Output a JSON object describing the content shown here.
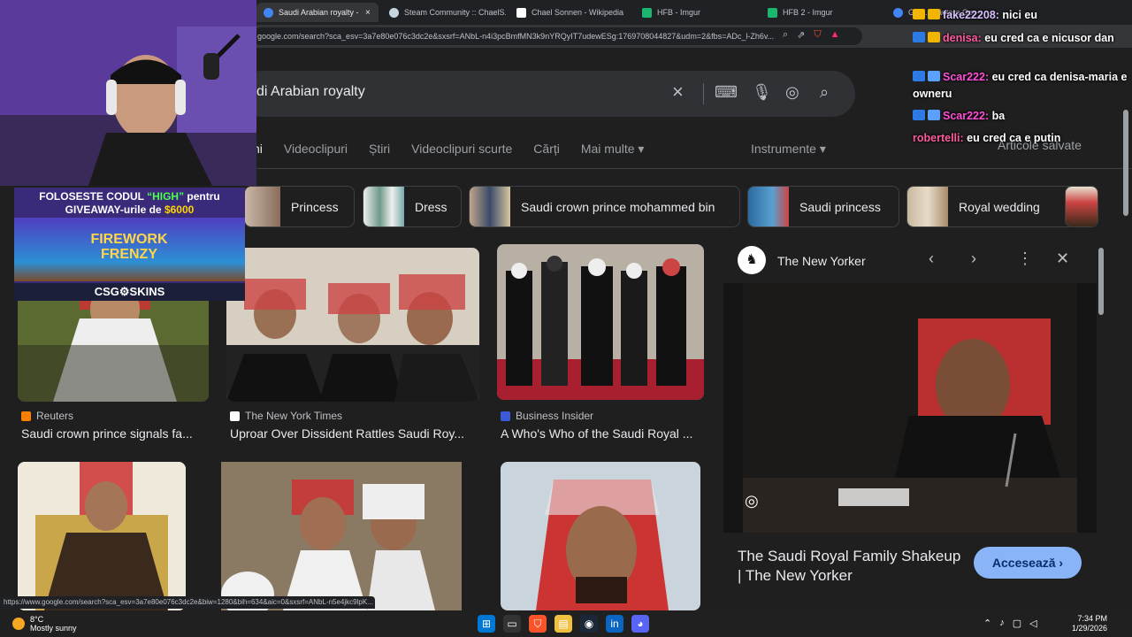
{
  "browser": {
    "tabs": [
      {
        "title": "Saudi Arabian royalty - Căutare Google",
        "active": true
      },
      {
        "title": "Steam Community :: ChaelS."
      },
      {
        "title": "Chael Sonnen - Wikipedia"
      },
      {
        "title": "HFB - Imgur"
      },
      {
        "title": "HFB 2 - Imgur"
      },
      {
        "title": "Gyh... Căutare Google"
      }
    ],
    "tab_close": "×",
    "url": "google.com/search?sca_esv=3a7e80e076c3dc2e&sxsrf=ANbL-n4i3pcBmfMN3k9nYRQyIT7udewESg:1769708044827&udm=2&fbs=ADc_l-Zh6v..."
  },
  "search": {
    "query": "di Arabian royalty",
    "clear_icon": "×"
  },
  "nav": {
    "tabs": [
      "ni",
      "Videoclipuri",
      "Știri",
      "Videoclipuri scurte",
      "Cărți",
      "Mai multe ▾"
    ],
    "tools": "Instrumente ▾",
    "saved": "Articole salvate"
  },
  "chips": [
    "Princess",
    "Dress",
    "Saudi crown prince mohammed bin",
    "Saudi princess",
    "Royal wedding"
  ],
  "results": [
    {
      "source": "Reuters",
      "title": "Saudi crown prince signals fa...",
      "src_color": "#ff8000"
    },
    {
      "source": "The New York Times",
      "title": "Uproar Over Dissident Rattles Saudi Roy...",
      "src_color": "#ffffff"
    },
    {
      "source": "Business Insider",
      "title": "A Who's Who of the Saudi Royal ...",
      "src_color": "#3b5bdb"
    }
  ],
  "panel": {
    "source": "The New Yorker",
    "title": "The Saudi Royal Family Shakeup | The New Yorker",
    "visit_label": "Accesează ›"
  },
  "overlay": {
    "promo_line1_a": "FOLOSESTE CODUL ",
    "promo_code": "“HIGH”",
    "promo_line1_b": " pentru",
    "promo_line2_a": "GIVEAWAY-urile de ",
    "promo_amount": "$6000",
    "game_title": "FIREWORK FRENZY",
    "brand": "CSG⚙SKINS"
  },
  "chat": [
    {
      "user": "fake22208:",
      "msg": " nici eu"
    },
    {
      "user": "denisa:",
      "msg": " eu cred ca e nicusor dan"
    },
    {
      "user": "Scar222:",
      "msg": " eu cred ca denisa-maria e owneru"
    },
    {
      "user": "Scar222:",
      "msg": " ba"
    },
    {
      "user": "robertelli:",
      "msg": " eu cred ca e putin"
    }
  ],
  "status_url": "https://www.google.com/search?sca_esv=3a7e80e076c3dc2e&biw=1280&bih=634&aic=0&sxsrf=ANbL-n5e4jkc9lpK...",
  "taskbar": {
    "temp": "8°C",
    "weather": "Mostly sunny",
    "time": "7:34 PM",
    "date": "1/29/2026"
  }
}
